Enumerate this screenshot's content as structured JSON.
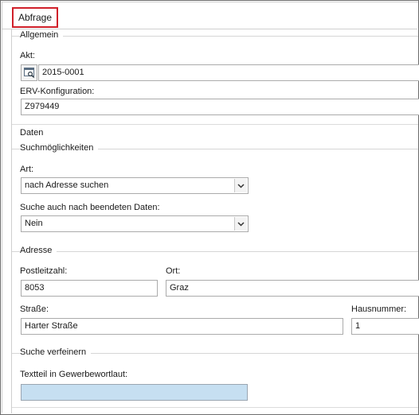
{
  "tab": {
    "label": "Abfrage"
  },
  "allgemein": {
    "title": "Allgemein",
    "akt_label": "Akt:",
    "akt_value": "2015-0001",
    "erv_label": "ERV-Konfiguration:",
    "erv_value": "Z979449"
  },
  "daten": {
    "title": "Daten",
    "such_title": "Suchmöglichkeiten",
    "art_label": "Art:",
    "art_value": "nach Adresse suchen",
    "beendet_label": "Suche auch nach beendeten Daten:",
    "beendet_value": "Nein"
  },
  "adresse": {
    "title": "Adresse",
    "plz_label": "Postleitzahl:",
    "plz_value": "8053",
    "ort_label": "Ort:",
    "ort_value": "Graz",
    "strasse_label": "Straße:",
    "strasse_value": "Harter Straße",
    "hausnr_label": "Hausnummer:",
    "hausnr_value": "1"
  },
  "verfeinern": {
    "title": "Suche verfeinern",
    "textteil_label": "Textteil in Gewerbewortlaut:",
    "textteil_value": ""
  },
  "icons": {
    "lookup": "search-lookup-icon",
    "dropdown": "chevron-down-icon"
  },
  "colors": {
    "tab_border": "#d0202a",
    "highlight_input": "#c6dff1"
  }
}
